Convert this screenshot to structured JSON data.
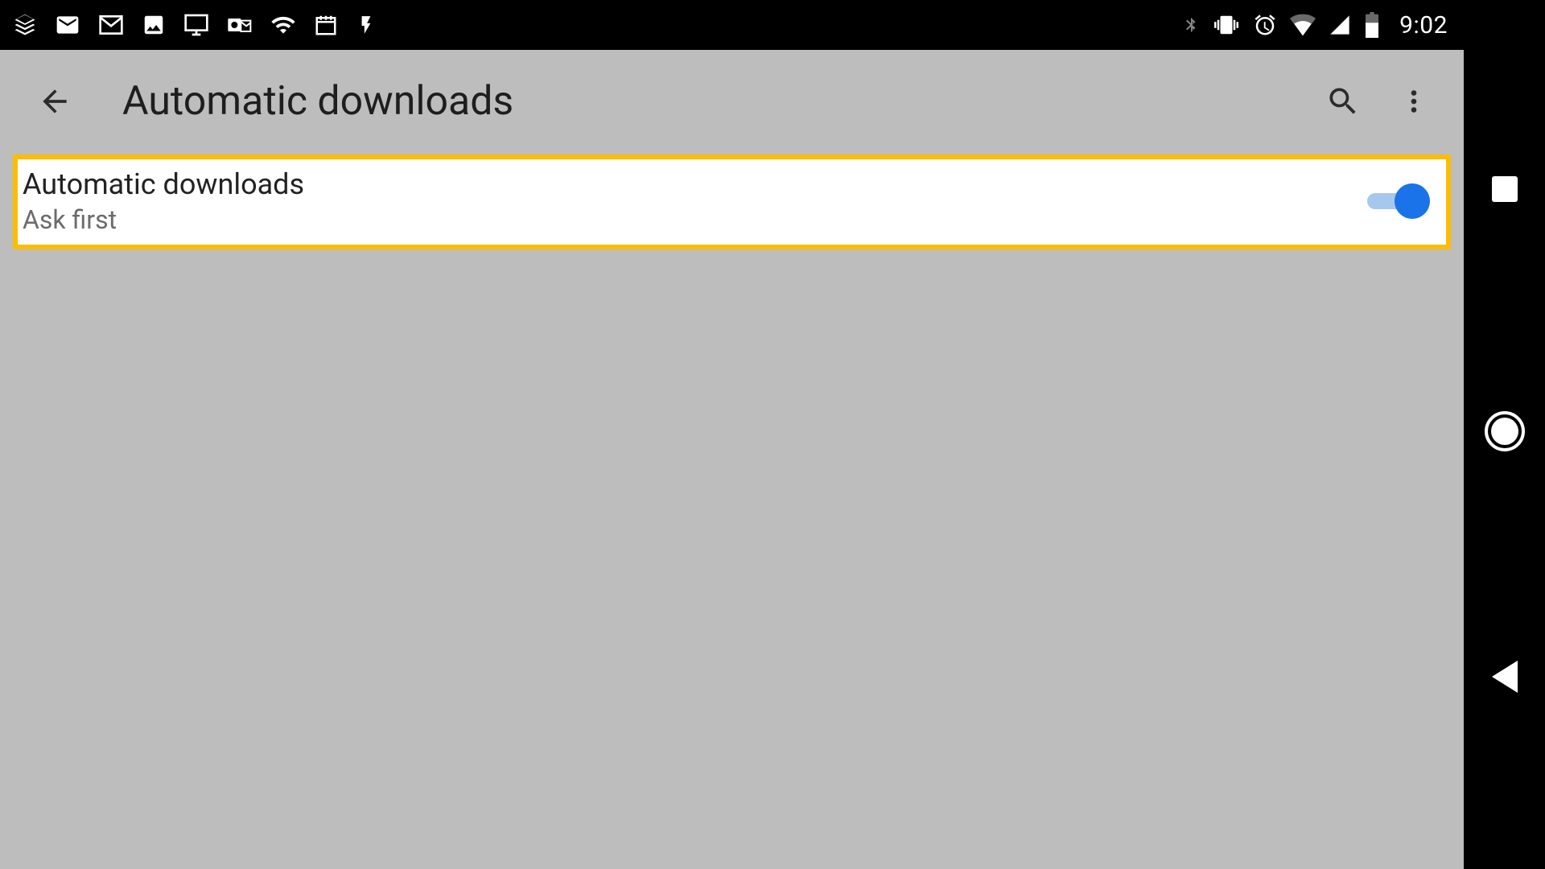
{
  "status_bar": {
    "time": "9:02"
  },
  "app_bar": {
    "title": "Automatic downloads"
  },
  "setting": {
    "title": "Automatic downloads",
    "subtitle": "Ask first",
    "enabled": true
  }
}
